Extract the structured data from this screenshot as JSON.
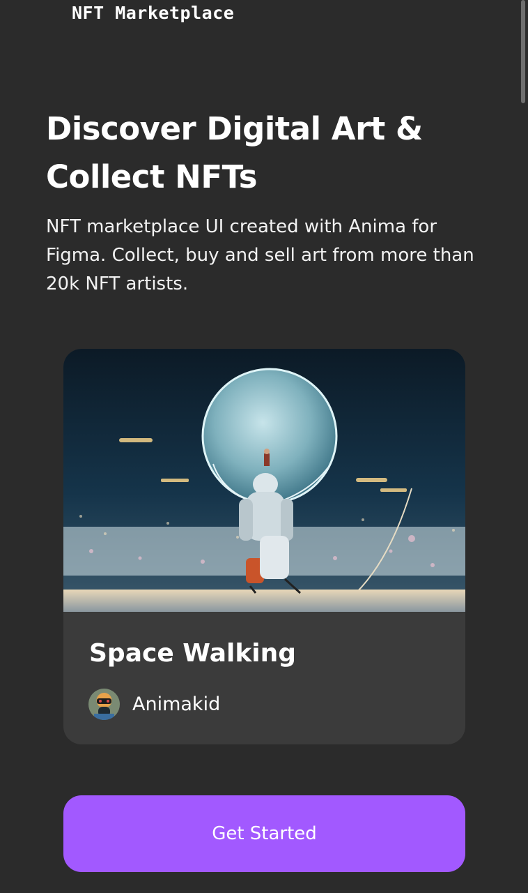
{
  "header": {
    "brand": "NFT Marketplace",
    "logo_icon": "storefront-icon"
  },
  "hero": {
    "title": "Discover Digital Art & Collect NFTs",
    "subtitle": "NFT marketplace UI created with Anima for Figma. Collect, buy and sell art from more than 20k NFT artists."
  },
  "featured": {
    "title": "Space Walking",
    "artist": "Animakid",
    "image_icon": "space-walking-artwork",
    "avatar_icon": "artist-avatar"
  },
  "cta": {
    "label": "Get Started"
  },
  "colors": {
    "background": "#2b2b2b",
    "card": "#3b3b3b",
    "accent": "#a259ff"
  }
}
